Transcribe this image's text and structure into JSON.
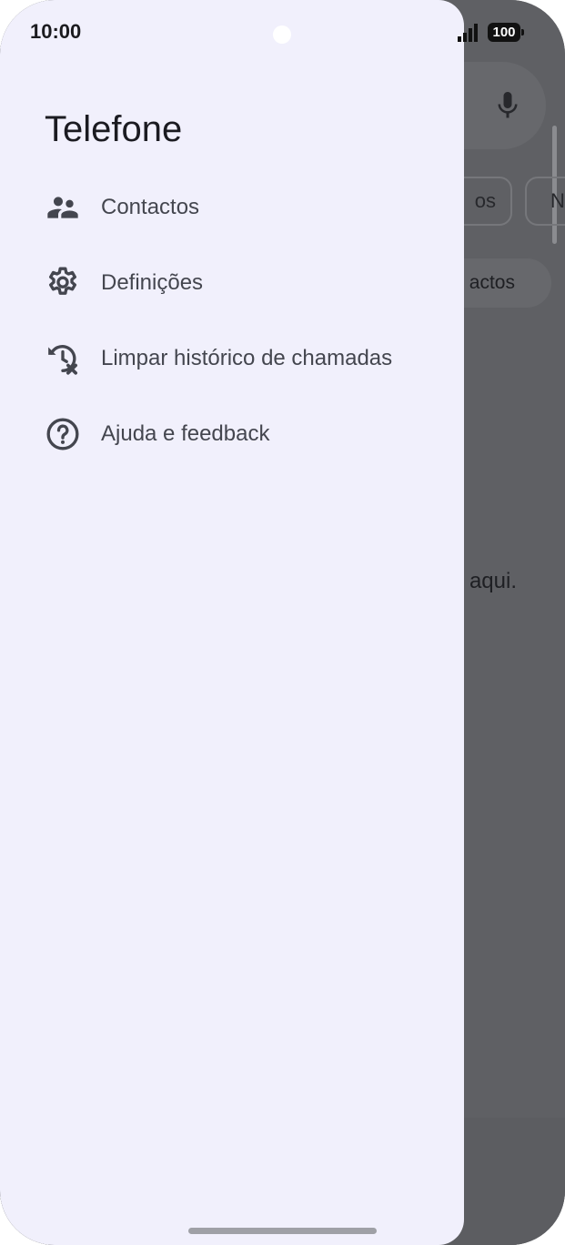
{
  "status_bar": {
    "time": "10:00",
    "battery": "100"
  },
  "background_app": {
    "chips": [
      "os",
      "N"
    ],
    "pill_label": "actos",
    "empty_text": "aqui."
  },
  "drawer": {
    "title": "Telefone",
    "items": [
      {
        "label": "Contactos",
        "icon": "contacts-icon"
      },
      {
        "label": "Definições",
        "icon": "settings-gear-icon"
      },
      {
        "label": "Limpar histórico de chamadas",
        "icon": "clear-history-icon"
      },
      {
        "label": "Ajuda e feedback",
        "icon": "help-icon"
      }
    ]
  },
  "colors": {
    "drawer_bg": "#f1f0fc",
    "scrim": "#5f6064",
    "icon": "#44464f"
  }
}
